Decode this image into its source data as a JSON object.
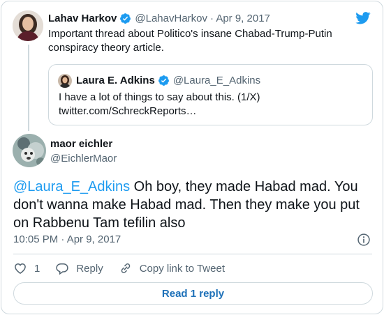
{
  "tweet": {
    "author_name": "Lahav Harkov",
    "author_handle": "@LahavHarkov",
    "date": "· Apr 9, 2017",
    "text_line1": "Important thread about Politico's insane Chabad-Trump-Putin",
    "text_line2": "conspiracy theory article."
  },
  "quoted": {
    "author_name": "Laura E. Adkins",
    "author_handle": "@Laura_E_Adkins",
    "text_line1": "I have a lot of things to say about this. (1/X)",
    "text_line2": "twitter.com/SchreckReports…"
  },
  "reply": {
    "author_name": "maor eichler",
    "author_handle": "@EichlerMaor",
    "mention": "@Laura_E_Adkins",
    "text_line1_rest": " Oh boy, they made Habad mad. You",
    "text_line2": "don't wanna make Habad mad. Then they make you put",
    "text_line3": "on Rabbenu Tam tefilin also",
    "timestamp": "10:05 PM · Apr 9, 2017"
  },
  "actions": {
    "like_count": "1",
    "reply_label": "Reply",
    "copy_label": "Copy link to Tweet"
  },
  "read_reply_label": "Read 1 reply",
  "colors": {
    "accent": "#1d9bf0",
    "border": "#cfd9de",
    "secondary_text": "#536471"
  },
  "icons": [
    "twitter-bird-icon",
    "verified-badge-icon",
    "info-icon",
    "heart-icon",
    "reply-icon",
    "link-icon"
  ]
}
